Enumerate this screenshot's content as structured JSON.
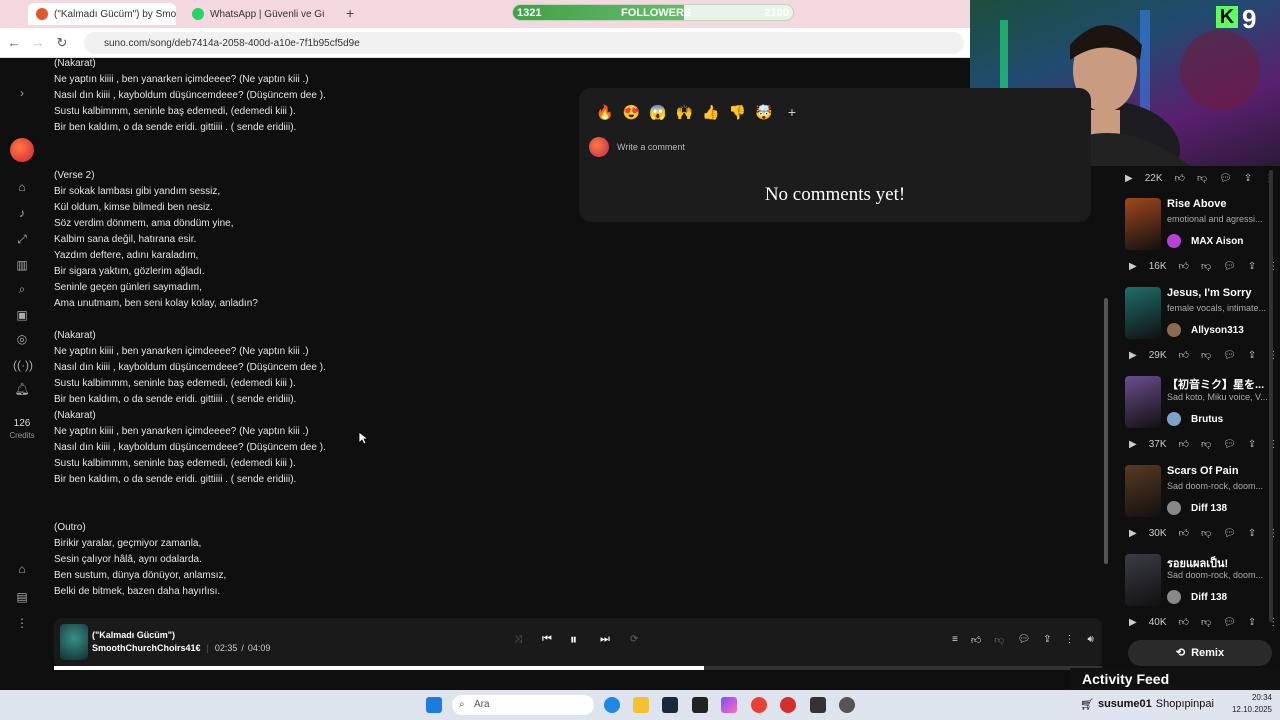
{
  "browser": {
    "tabs": [
      {
        "label": "(\"Kalmadı Gücüm\") by Smo",
        "active": true
      },
      {
        "label": "WhatsApp | Güvenli ve Güvenilir",
        "active": false
      }
    ],
    "new_tab": "+",
    "url": "suno.com/song/deb7414a-2058-400d-a10e-7f1b95cf5d9e"
  },
  "followers": {
    "current": "1321",
    "label": "FOLLOWERS",
    "goal": "2100",
    "progress": 0.61
  },
  "overlay": {
    "brand": "9",
    "activity_feed": "Activity Feed"
  },
  "sidebar": {
    "credits_count": "126",
    "credits_label": "Credits"
  },
  "lyrics": [
    "(Nakarat)",
    "Ne yaptın kiiii , ben yanarken içimdeeee? (Ne yaptın kiii .)",
    "Nasıl dın kiiii , kayboldum düşüncemdeee? (Düşüncem dee ).",
    "Sustu kalbimmm, seninle baş edemedi, (edemedi kiii ).",
    "Bir ben kaldım, o da sende eridi.  gittiiii . ( sende eridiii).",
    "",
    "",
    "(Verse 2)",
    "Bir sokak lambası gibi yandım sessiz,",
    "Kül oldum, kimse bilmedi ben nesiz.",
    "Söz verdim dönmem, ama döndüm yine,",
    "Kalbim sana değil, hatırana esir.",
    "Yazdım deftere, adını karaladım,",
    "Bir sigara yaktım, gözlerim ağladı.",
    "Seninle geçen günleri saymadım,",
    "Ama unutmam, ben seni kolay kolay, anladın?",
    "",
    "(Nakarat)",
    "Ne yaptın kiiii , ben yanarken içimdeeee? (Ne yaptın kiii .)",
    "Nasıl dın kiiii , kayboldum düşüncemdeee? (Düşüncem dee ).",
    "Sustu kalbimmm, seninle baş edemedi, (edemedi kiii ).",
    "Bir ben kaldım, o da sende eridi.  gittiiii . ( sende eridiii).",
    "(Nakarat)",
    "Ne yaptın kiiii , ben yanarken içimdeeee? (Ne yaptın kiii .)",
    "Nasıl dın kiiii , kayboldum düşüncemdeee? (Düşüncem dee ).",
    "Sustu kalbimmm, seninle baş edemedi, (edemedi kiii ).",
    "Bir ben kaldım, o da sende eridi.  gittiiii . ( sende eridiii).",
    "",
    "",
    "(Outro)",
    "Birikir yaralar, geçmiyor zamanla,",
    "Sesin çalıyor hâlâ, aynı odalarda.",
    "Ben sustum, dünya dönüyor, anlamsız,",
    "Belki de bitmek, bazen daha hayırlısı."
  ],
  "comments": {
    "placeholder": "Write a comment",
    "empty": "No comments yet!",
    "add": "+",
    "reactions": [
      "🔥",
      "😍",
      "😱",
      "🙌",
      "👍",
      "👎",
      "🤯"
    ]
  },
  "songs": [
    {
      "title": "Rise Above",
      "desc": "emotional and agressi...",
      "user": "MAX Aison",
      "plays": "16K",
      "thumb": "#a0481c",
      "avatar": "#b542d6"
    },
    {
      "title": "Jesus, I'm Sorry",
      "desc": "female vocals, intimate...",
      "user": "Allyson313",
      "plays": "29K",
      "thumb": "#1e6f6a",
      "avatar": "#8a6a52"
    },
    {
      "title": "【初音ミク】星を...",
      "desc": "Sad koto, Miku voice, V...",
      "user": "Brutus",
      "plays": "37K",
      "thumb": "#6b4e8e",
      "avatar": "#7fa2c9"
    },
    {
      "title": "Scars Of Pain",
      "desc": "Sad doom-rock, doom...",
      "user": "Diff 138",
      "plays": "30K",
      "thumb": "#5a3a22",
      "avatar": "#888888"
    },
    {
      "title": "รอยแผลเป็น!",
      "desc": "Sad doom-rock, doom...",
      "user": "Diff 138",
      "plays": "40K",
      "thumb": "#3c3c46",
      "avatar": "#888888"
    }
  ],
  "top_plays": "22K",
  "player": {
    "title": "(\"Kalmadı Gücüm\")",
    "artist": "SmoothChurchChoirs41€",
    "current": "02:35",
    "separator": "/",
    "duration": "04:09",
    "progress": 0.62
  },
  "remix_label": "Remix",
  "taskbar": {
    "search": "Ara",
    "chat_user": "susume01",
    "chat_msg": "Shopıpinpai",
    "time": "20:34",
    "date": "12.10.2025"
  }
}
